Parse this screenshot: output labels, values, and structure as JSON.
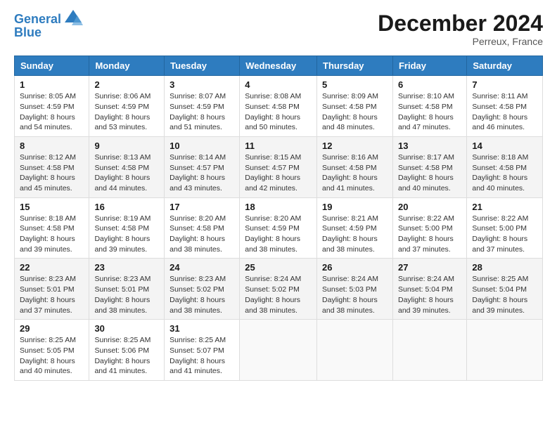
{
  "logo": {
    "line1": "General",
    "line2": "Blue"
  },
  "title": "December 2024",
  "location": "Perreux, France",
  "days_of_week": [
    "Sunday",
    "Monday",
    "Tuesday",
    "Wednesday",
    "Thursday",
    "Friday",
    "Saturday"
  ],
  "weeks": [
    [
      {
        "day": 1,
        "info": "Sunrise: 8:05 AM\nSunset: 4:59 PM\nDaylight: 8 hours\nand 54 minutes."
      },
      {
        "day": 2,
        "info": "Sunrise: 8:06 AM\nSunset: 4:59 PM\nDaylight: 8 hours\nand 53 minutes."
      },
      {
        "day": 3,
        "info": "Sunrise: 8:07 AM\nSunset: 4:59 PM\nDaylight: 8 hours\nand 51 minutes."
      },
      {
        "day": 4,
        "info": "Sunrise: 8:08 AM\nSunset: 4:58 PM\nDaylight: 8 hours\nand 50 minutes."
      },
      {
        "day": 5,
        "info": "Sunrise: 8:09 AM\nSunset: 4:58 PM\nDaylight: 8 hours\nand 48 minutes."
      },
      {
        "day": 6,
        "info": "Sunrise: 8:10 AM\nSunset: 4:58 PM\nDaylight: 8 hours\nand 47 minutes."
      },
      {
        "day": 7,
        "info": "Sunrise: 8:11 AM\nSunset: 4:58 PM\nDaylight: 8 hours\nand 46 minutes."
      }
    ],
    [
      {
        "day": 8,
        "info": "Sunrise: 8:12 AM\nSunset: 4:58 PM\nDaylight: 8 hours\nand 45 minutes."
      },
      {
        "day": 9,
        "info": "Sunrise: 8:13 AM\nSunset: 4:58 PM\nDaylight: 8 hours\nand 44 minutes."
      },
      {
        "day": 10,
        "info": "Sunrise: 8:14 AM\nSunset: 4:57 PM\nDaylight: 8 hours\nand 43 minutes."
      },
      {
        "day": 11,
        "info": "Sunrise: 8:15 AM\nSunset: 4:57 PM\nDaylight: 8 hours\nand 42 minutes."
      },
      {
        "day": 12,
        "info": "Sunrise: 8:16 AM\nSunset: 4:58 PM\nDaylight: 8 hours\nand 41 minutes."
      },
      {
        "day": 13,
        "info": "Sunrise: 8:17 AM\nSunset: 4:58 PM\nDaylight: 8 hours\nand 40 minutes."
      },
      {
        "day": 14,
        "info": "Sunrise: 8:18 AM\nSunset: 4:58 PM\nDaylight: 8 hours\nand 40 minutes."
      }
    ],
    [
      {
        "day": 15,
        "info": "Sunrise: 8:18 AM\nSunset: 4:58 PM\nDaylight: 8 hours\nand 39 minutes."
      },
      {
        "day": 16,
        "info": "Sunrise: 8:19 AM\nSunset: 4:58 PM\nDaylight: 8 hours\nand 39 minutes."
      },
      {
        "day": 17,
        "info": "Sunrise: 8:20 AM\nSunset: 4:58 PM\nDaylight: 8 hours\nand 38 minutes."
      },
      {
        "day": 18,
        "info": "Sunrise: 8:20 AM\nSunset: 4:59 PM\nDaylight: 8 hours\nand 38 minutes."
      },
      {
        "day": 19,
        "info": "Sunrise: 8:21 AM\nSunset: 4:59 PM\nDaylight: 8 hours\nand 38 minutes."
      },
      {
        "day": 20,
        "info": "Sunrise: 8:22 AM\nSunset: 5:00 PM\nDaylight: 8 hours\nand 37 minutes."
      },
      {
        "day": 21,
        "info": "Sunrise: 8:22 AM\nSunset: 5:00 PM\nDaylight: 8 hours\nand 37 minutes."
      }
    ],
    [
      {
        "day": 22,
        "info": "Sunrise: 8:23 AM\nSunset: 5:01 PM\nDaylight: 8 hours\nand 37 minutes."
      },
      {
        "day": 23,
        "info": "Sunrise: 8:23 AM\nSunset: 5:01 PM\nDaylight: 8 hours\nand 38 minutes."
      },
      {
        "day": 24,
        "info": "Sunrise: 8:23 AM\nSunset: 5:02 PM\nDaylight: 8 hours\nand 38 minutes."
      },
      {
        "day": 25,
        "info": "Sunrise: 8:24 AM\nSunset: 5:02 PM\nDaylight: 8 hours\nand 38 minutes."
      },
      {
        "day": 26,
        "info": "Sunrise: 8:24 AM\nSunset: 5:03 PM\nDaylight: 8 hours\nand 38 minutes."
      },
      {
        "day": 27,
        "info": "Sunrise: 8:24 AM\nSunset: 5:04 PM\nDaylight: 8 hours\nand 39 minutes."
      },
      {
        "day": 28,
        "info": "Sunrise: 8:25 AM\nSunset: 5:04 PM\nDaylight: 8 hours\nand 39 minutes."
      }
    ],
    [
      {
        "day": 29,
        "info": "Sunrise: 8:25 AM\nSunset: 5:05 PM\nDaylight: 8 hours\nand 40 minutes."
      },
      {
        "day": 30,
        "info": "Sunrise: 8:25 AM\nSunset: 5:06 PM\nDaylight: 8 hours\nand 41 minutes."
      },
      {
        "day": 31,
        "info": "Sunrise: 8:25 AM\nSunset: 5:07 PM\nDaylight: 8 hours\nand 41 minutes."
      },
      null,
      null,
      null,
      null
    ]
  ]
}
